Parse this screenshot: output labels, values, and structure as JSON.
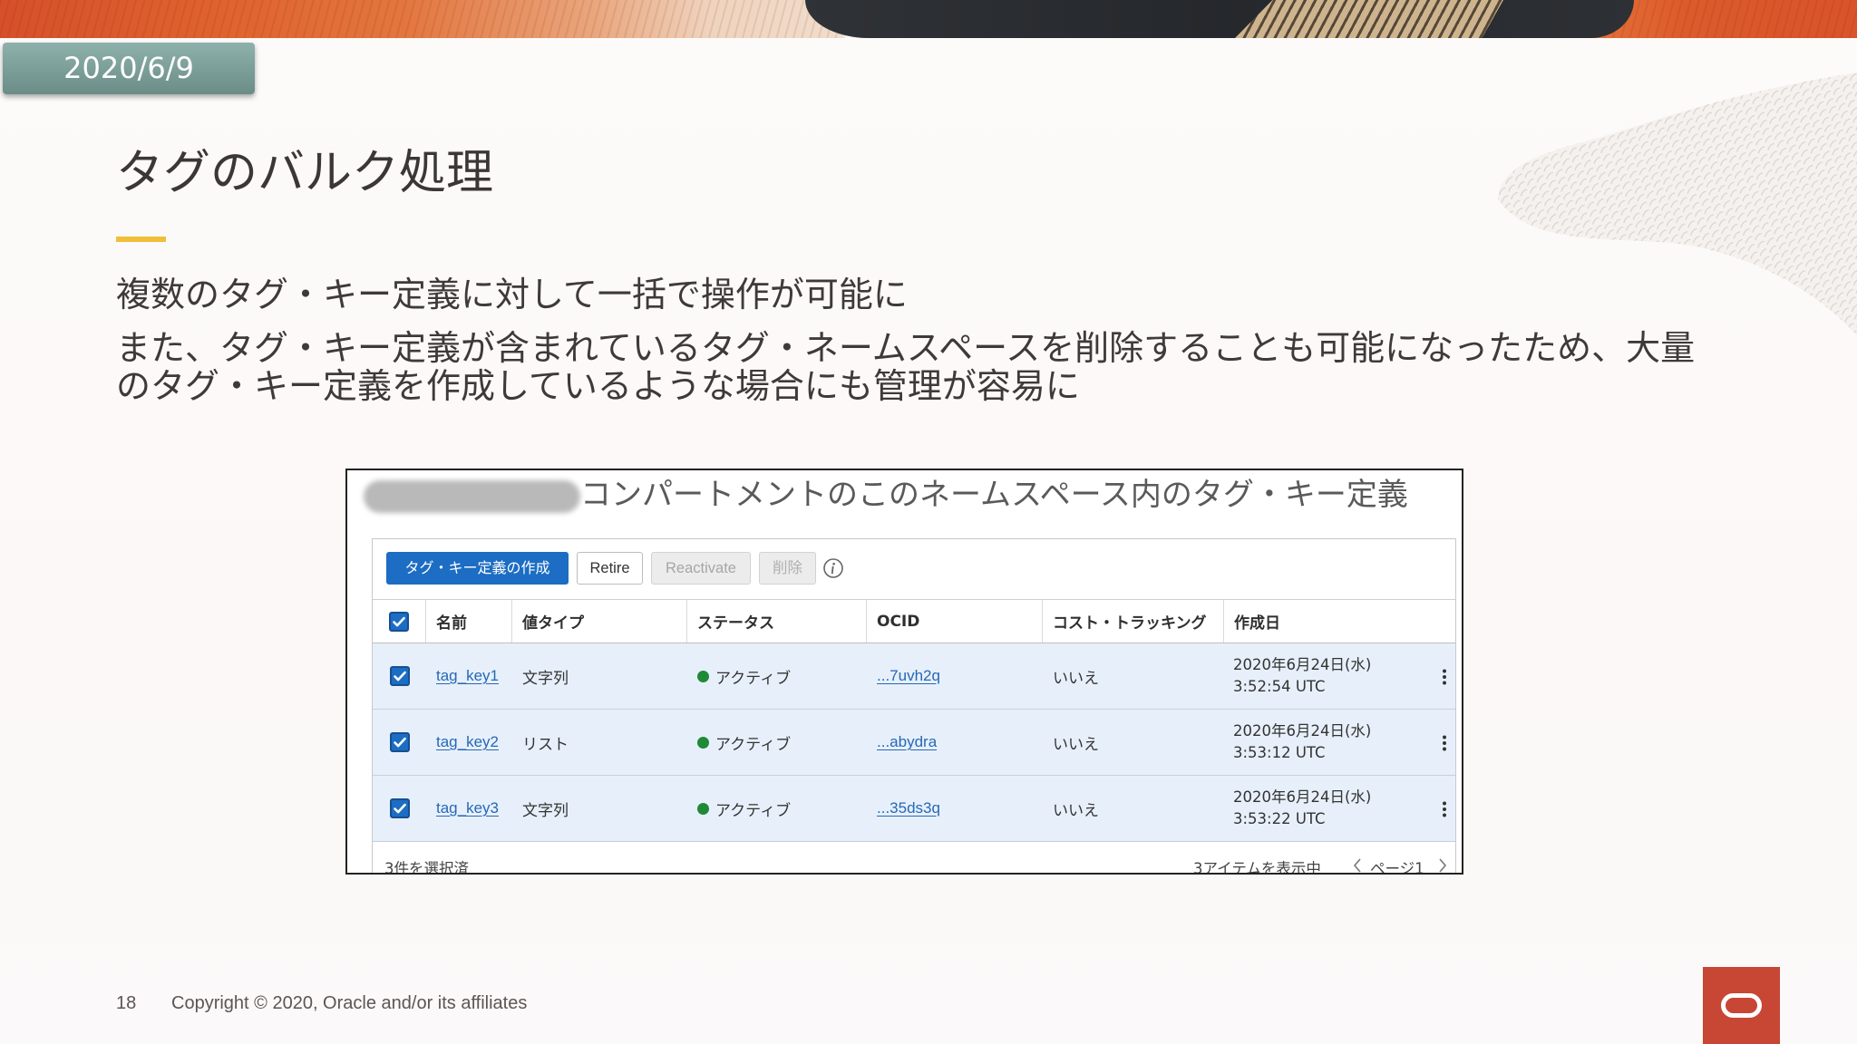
{
  "slide": {
    "date_badge": "2020/6/9",
    "title": "タグのバルク処理",
    "bullets": [
      "複数のタグ・キー定義に対して一括で操作が可能に",
      "また、タグ・キー定義が含まれているタグ・ネームスペースを削除することも可能になったため、大量のタグ・キー定義を作成しているような場合にも管理が容易に"
    ],
    "footer": {
      "page_number": "18",
      "copyright": "Copyright © 2020, Oracle and/or its affiliates",
      "logo_icon": "oracle-logo-icon"
    }
  },
  "console": {
    "heading": "コンパートメントのこのネームスペース内のタグ・キー定義",
    "toolbar": {
      "create_label": "タグ・キー定義の作成",
      "retire_label": "Retire",
      "reactivate_label": "Reactivate",
      "delete_label": "削除",
      "info_icon": "info-icon"
    },
    "table": {
      "select_all_checked": true,
      "columns": [
        "名前",
        "値タイプ",
        "ステータス",
        "OCID",
        "コスト・トラッキング",
        "作成日"
      ],
      "rows": [
        {
          "selected": true,
          "name": "tag_key1",
          "value_type": "文字列",
          "status": "アクティブ",
          "ocid": "...7uvh2q",
          "cost_tracking": "いいえ",
          "created_date": "2020年6月24日(水)",
          "created_time": "3:52:54 UTC"
        },
        {
          "selected": true,
          "name": "tag_key2",
          "value_type": "リスト",
          "status": "アクティブ",
          "ocid": "...abydra",
          "cost_tracking": "いいえ",
          "created_date": "2020年6月24日(水)",
          "created_time": "3:53:12 UTC"
        },
        {
          "selected": true,
          "name": "tag_key3",
          "value_type": "文字列",
          "status": "アクティブ",
          "ocid": "...35ds3q",
          "cost_tracking": "いいえ",
          "created_date": "2020年6月24日(水)",
          "created_time": "3:53:22 UTC"
        }
      ],
      "icons": {
        "check": "checkmark-icon",
        "status": "status-dot-icon",
        "row_menu": "kebab-menu-icon"
      }
    },
    "footer": {
      "selected_count": "3件を選択済",
      "items_shown": "3アイテムを表示中",
      "page": "ページ1",
      "prev_icon": "chevron-left-icon",
      "next_icon": "chevron-right-icon"
    }
  },
  "theme": {
    "accent_yellow": "#f0bf3a",
    "oracle_red": "#c74634",
    "primary_blue": "#1c6dc3",
    "link_blue": "#2668b8",
    "status_green": "#1f8a36",
    "selected_row": "#e7f0fa",
    "badge_top": "#8fb1ab",
    "badge_bottom": "#6a8d87"
  }
}
